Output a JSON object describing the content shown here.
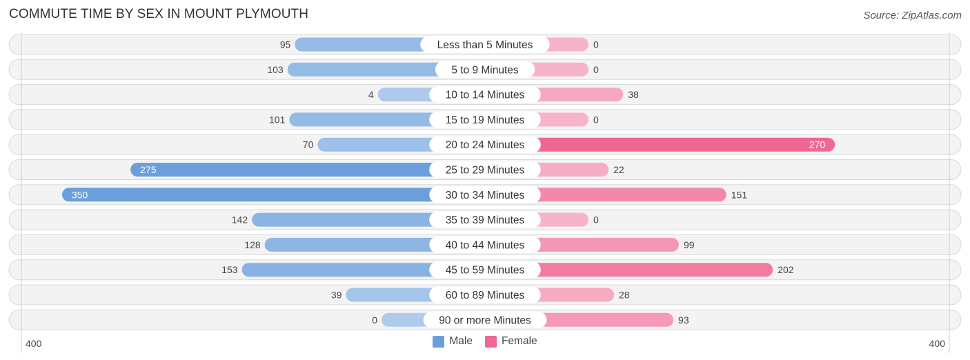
{
  "header": {
    "title": "COMMUTE TIME BY SEX IN MOUNT PLYMOUTH",
    "source": "Source: ZipAtlas.com"
  },
  "legend": {
    "male_label": "Male",
    "female_label": "Female",
    "male_color": "#6a9fdc",
    "female_color": "#f06892"
  },
  "axis": {
    "left_label": "400",
    "right_label": "400"
  },
  "chart_data": {
    "type": "bar",
    "orientation": "horizontal-diverging",
    "title": "COMMUTE TIME BY SEX IN MOUNT PLYMOUTH",
    "categories": [
      "Less than 5 Minutes",
      "5 to 9 Minutes",
      "10 to 14 Minutes",
      "15 to 19 Minutes",
      "20 to 24 Minutes",
      "25 to 29 Minutes",
      "30 to 34 Minutes",
      "35 to 39 Minutes",
      "40 to 44 Minutes",
      "45 to 59 Minutes",
      "60 to 89 Minutes",
      "90 or more Minutes"
    ],
    "series": [
      {
        "name": "Male",
        "side": "left",
        "values": [
          95,
          103,
          4,
          101,
          70,
          275,
          350,
          142,
          128,
          153,
          39,
          0
        ]
      },
      {
        "name": "Female",
        "side": "right",
        "values": [
          0,
          0,
          38,
          0,
          270,
          22,
          151,
          0,
          99,
          202,
          28,
          93
        ]
      }
    ],
    "xlim": [
      -400,
      400
    ],
    "xtick_labels": [
      "400",
      "400"
    ],
    "legend_position": "bottom-center",
    "grid": false
  }
}
